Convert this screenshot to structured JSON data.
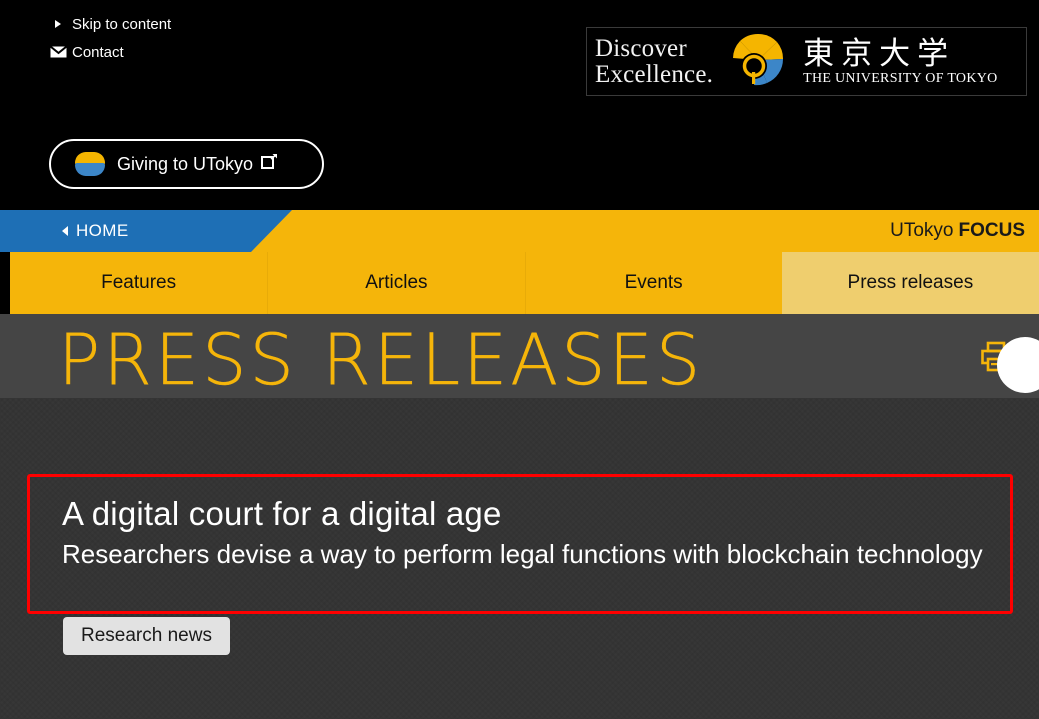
{
  "utility": {
    "links": [
      {
        "label": "Skip to content",
        "icon": "arrow-right-icon"
      },
      {
        "label": "Contact",
        "icon": "mail-icon"
      }
    ],
    "giving": {
      "label": "Giving to UTokyo",
      "external_icon": "external-link-icon"
    }
  },
  "logo": {
    "tagline_line1": "Discover",
    "tagline_line2": "Excellence.",
    "emblem": "ginkgo-leaf-emblem",
    "japanese_name": "東京大学",
    "english_name": "THE UNIVERSITY OF TOKYO"
  },
  "breadcrumb": {
    "home_label": "HOME",
    "back_icon": "triangle-left-icon",
    "site_section": "UTokyo",
    "site_section_bold": "FOCUS"
  },
  "tabs": [
    {
      "label": "Features",
      "active": false
    },
    {
      "label": "Articles",
      "active": false
    },
    {
      "label": "Events",
      "active": false
    },
    {
      "label": "Press releases",
      "active": true
    }
  ],
  "page": {
    "title": "PRESS RELEASES",
    "print_icon": "printer-icon",
    "fab_icon": "circle-button"
  },
  "article": {
    "headline": "A digital court for a digital age",
    "subheadline": "Researchers devise a way to perform legal functions with blockchain technology",
    "badge": "Research news"
  },
  "colors": {
    "brand_yellow": "#F5B50A",
    "tab_active_yellow": "#EFCE6E",
    "breadcrumb_blue": "#1E6FB5",
    "title_band_gray": "#454545",
    "content_gray": "#333333",
    "highlight_red": "#FF0000",
    "badge_gray": "#E2E2E2",
    "emblem_blue": "#3C86C8"
  }
}
